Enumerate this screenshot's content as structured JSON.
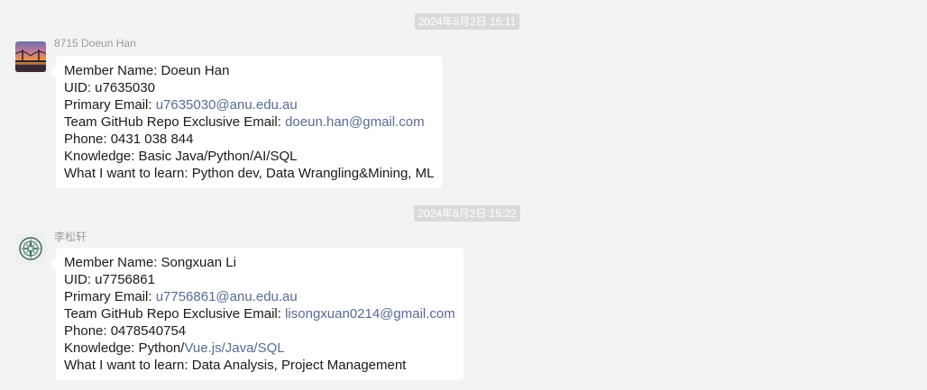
{
  "messages": [
    {
      "timestamp": "2024年8月2日 15:11",
      "sender": "8715 Doeun Han",
      "lines": {
        "name": "Member Name: Doeun Han",
        "uid": "UID: u7635030",
        "primary_label": "Primary Email: ",
        "primary_email": "u7635030@anu.edu.au",
        "team_label": "Team GitHub Repo Exclusive Email: ",
        "team_email": "doeun.han@gmail.com",
        "phone": "Phone: 0431 038 844",
        "knowledge_label": "Knowledge: Basic Java/Python/AI/SQL",
        "learn": "What I want to learn: Python dev, Data Wrangling&Mining, ML"
      }
    },
    {
      "timestamp": "2024年8月2日 15:22",
      "sender": "李松轩",
      "lines": {
        "name": "Member Name: Songxuan Li",
        "uid": "UID: u7756861",
        "primary_label": "Primary Email: ",
        "primary_email": "u7756861@anu.edu.au",
        "team_label": "Team GitHub Repo Exclusive Email: ",
        "team_email": "lisongxuan0214@gmail.com",
        "phone": "Phone: 0478540754",
        "knowledge_label": "Knowledge: Python/",
        "knowledge_link": "Vue.js/Java/SQL",
        "learn": "What I want to learn: Data Analysis, Project Management"
      }
    }
  ],
  "colors": {
    "background": "#f3f3f3",
    "bubble": "#ffffff",
    "link": "#576b95",
    "timestamp_bg": "#dadada"
  }
}
